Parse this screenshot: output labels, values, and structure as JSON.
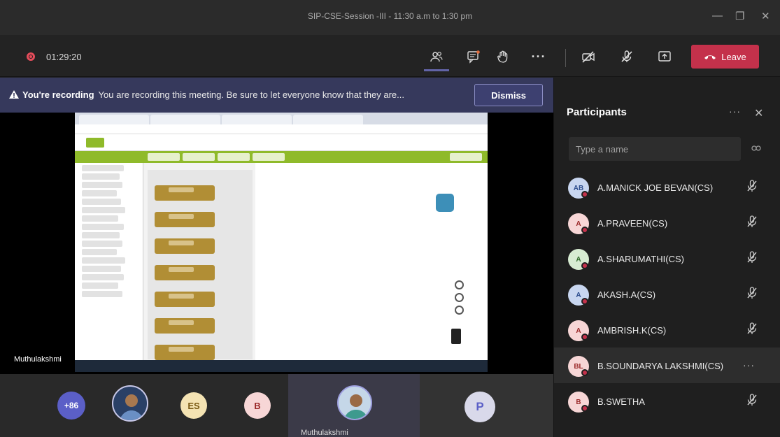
{
  "window": {
    "title": "SIP-CSE-Session -III - 11:30 a.m to 1:30 pm",
    "controls": [
      "minimize-icon",
      "maximize-icon",
      "close-icon"
    ]
  },
  "toolbar": {
    "timer": "01:29:20",
    "recording_color": "#e44c5a",
    "icons": [
      "participants-icon",
      "chat-icon",
      "raise-hand-icon",
      "more-actions-icon",
      "camera-off-icon",
      "mic-muted-icon",
      "share-tray-icon"
    ],
    "leave_label": "Leave",
    "leave_color": "#c4314b"
  },
  "banner": {
    "title": "You're recording",
    "message": "You are recording this meeting. Be sure to let everyone know that they are...",
    "dismiss_label": "Dismiss"
  },
  "stage": {
    "speaker_name": "Muthulakshmi"
  },
  "gallery": {
    "overflow_count": "+86",
    "initials": [
      "ES",
      "B",
      "P"
    ],
    "active_speaker": "Muthulakshmi"
  },
  "participants_panel": {
    "title": "Participants",
    "search_placeholder": "Type a name",
    "people": [
      {
        "initials": "AB",
        "name": "A.MANICK JOE BEVAN(CS)",
        "avatar_bg": "#c8d6f0",
        "avatar_fg": "#2f4f8f",
        "muted": true
      },
      {
        "initials": "A",
        "name": "A.PRAVEEN(CS)",
        "avatar_bg": "#f7d6d6",
        "avatar_fg": "#9b2a2a",
        "muted": true
      },
      {
        "initials": "A",
        "name": "A.SHARUMATHI(CS)",
        "avatar_bg": "#d7ecd2",
        "avatar_fg": "#2f6b2a",
        "muted": true
      },
      {
        "initials": "A",
        "name": "AKASH.A(CS)",
        "avatar_bg": "#c8d6f0",
        "avatar_fg": "#2f4f8f",
        "muted": true
      },
      {
        "initials": "A",
        "name": "AMBRISH.K(CS)",
        "avatar_bg": "#f7d6d6",
        "avatar_fg": "#9b2a2a",
        "muted": true
      },
      {
        "initials": "BL",
        "name": "B.SOUNDARYA LAKSHMI(CS)",
        "avatar_bg": "#f7d6d6",
        "avatar_fg": "#9b2a2a",
        "muted": false
      },
      {
        "initials": "B",
        "name": "B.SWETHA",
        "avatar_bg": "#f7d6d6",
        "avatar_fg": "#9b2a2a",
        "muted": true
      }
    ]
  }
}
